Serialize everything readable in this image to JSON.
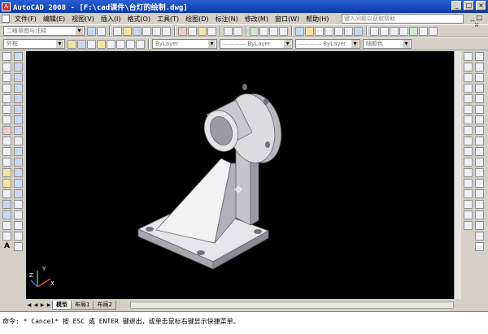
{
  "window": {
    "title": "AutoCAD 2008 - [F:\\cad课件\\台灯的绘制.dwg]",
    "app_icon": "A",
    "buttons": [
      "_",
      "□",
      "×"
    ]
  },
  "menu": {
    "items": [
      "文件(F)",
      "编辑(E)",
      "视图(V)",
      "插入(I)",
      "格式(O)",
      "工具(T)",
      "绘图(D)",
      "标注(N)",
      "修改(M)",
      "窗口(W)",
      "帮助(H)"
    ],
    "help_placeholder": "键入问题以获取帮助",
    "close_label": "_ □ ×"
  },
  "toolbar": {
    "workspace_combo": "二维草图与注释",
    "layer_combo": "外框",
    "color_combo": "ByLayer",
    "linetype_combo": "———— ByLayer",
    "lineweight_combo": "———— ByLayer",
    "plotstyle_combo": "随颜色"
  },
  "layout_tabs": [
    "模型",
    "布局1",
    "布局2"
  ],
  "command": {
    "text": "命令: * Cancel* 按 ESC 或 ENTER 键退出，或单击鼠标右键显示快捷菜单。"
  },
  "ucs": {
    "x_label": "X",
    "y_label": "Y",
    "z_label": "Z"
  },
  "colors": {
    "canvas": "#000000",
    "model_face": "#d8d8dc",
    "model_dark": "#8c8c94",
    "titlebar": "#0a3aa8"
  }
}
